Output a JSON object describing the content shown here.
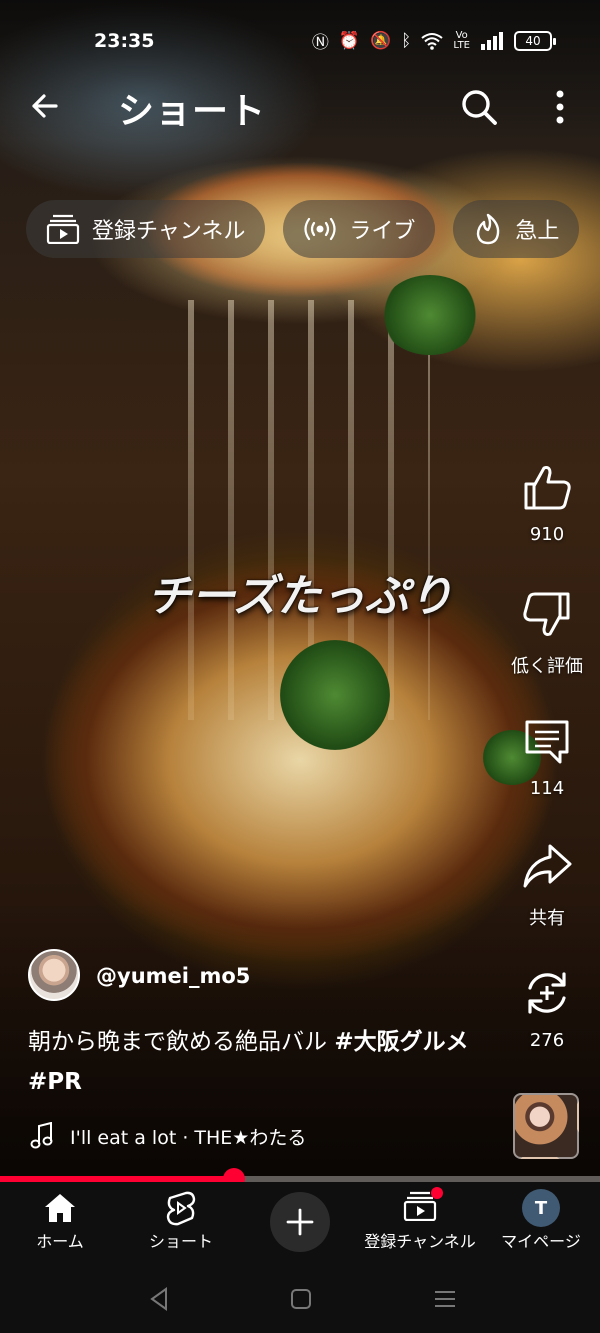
{
  "status_bar": {
    "time": "23:35",
    "battery": "40",
    "icons": [
      "nfc-icon",
      "alarm-icon",
      "mute-icon",
      "bluetooth-icon",
      "wifi-icon",
      "volte-icon",
      "signal-icon",
      "battery-icon"
    ]
  },
  "header": {
    "title": "ショート"
  },
  "chips": [
    {
      "label": "登録チャンネル",
      "icon": "subscriptions-icon"
    },
    {
      "label": "ライブ",
      "icon": "live-icon"
    },
    {
      "label": "急上",
      "icon": "trending-icon"
    }
  ],
  "video": {
    "overlay_text": "チーズたっぷり",
    "channel_handle": "@yumei_mo5",
    "caption_text": "朝から晩まで飲める絶品バル ",
    "caption_tags": "#大阪グルメ #PR",
    "music": "I'll eat a lot · THE★わたる",
    "progress": 0.39
  },
  "actions": {
    "like_count": "910",
    "dislike_label": "低く評価",
    "comment_count": "114",
    "share_label": "共有",
    "remix_count": "276"
  },
  "bottom_nav": {
    "home": "ホーム",
    "shorts": "ショート",
    "subscriptions": "登録チャンネル",
    "mypage": "マイページ",
    "mypage_initial": "T"
  },
  "colors": {
    "accent": "#ff0033",
    "nav_bg": "#0f0f0f"
  }
}
